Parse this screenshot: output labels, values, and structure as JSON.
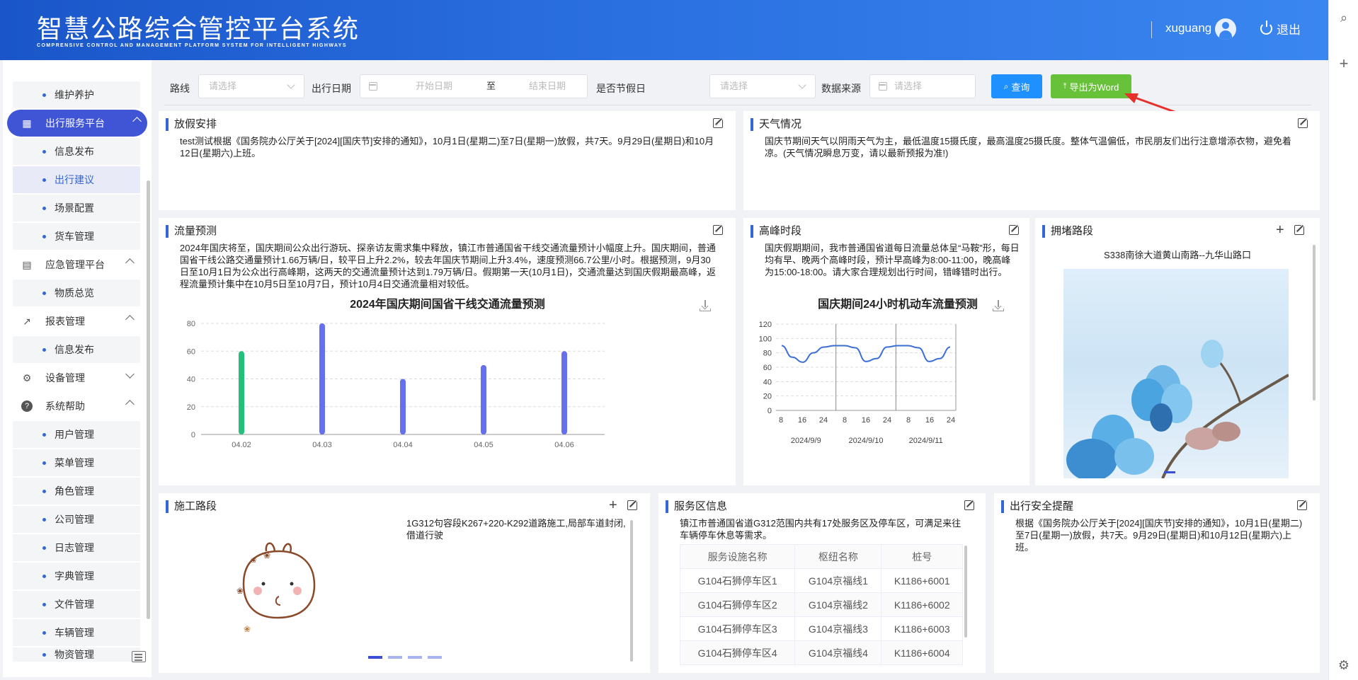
{
  "header": {
    "title": "智慧公路综合管控平台系统",
    "subtitle": "COMPRENSIVE CONTROL AND MANAGEMENT PLATFORM SYSTEM FOR INTELLIGENT HIGHWAYS",
    "username": "xuguang",
    "logout": "退出"
  },
  "sidebar": {
    "items": [
      {
        "label": "维护养护",
        "type": "sub"
      },
      {
        "label": "出行服务平台",
        "type": "group",
        "icon": "dashboard-icon",
        "active": true
      },
      {
        "label": "信息发布",
        "type": "sub"
      },
      {
        "label": "出行建议",
        "type": "sub",
        "active": true
      },
      {
        "label": "场景配置",
        "type": "sub"
      },
      {
        "label": "货车管理",
        "type": "sub"
      },
      {
        "label": "应急管理平台",
        "type": "group",
        "icon": "document-icon"
      },
      {
        "label": "物质总览",
        "type": "sub"
      },
      {
        "label": "报表管理",
        "type": "group",
        "icon": "chart-icon"
      },
      {
        "label": "信息发布",
        "type": "sub"
      },
      {
        "label": "设备管理",
        "type": "group",
        "icon": "gear-icon"
      },
      {
        "label": "系统帮助",
        "type": "group",
        "icon": "help-icon"
      },
      {
        "label": "用户管理",
        "type": "sub"
      },
      {
        "label": "菜单管理",
        "type": "sub"
      },
      {
        "label": "角色管理",
        "type": "sub"
      },
      {
        "label": "公司管理",
        "type": "sub"
      },
      {
        "label": "日志管理",
        "type": "sub"
      },
      {
        "label": "字典管理",
        "type": "sub"
      },
      {
        "label": "文件管理",
        "type": "sub"
      },
      {
        "label": "车辆管理",
        "type": "sub"
      },
      {
        "label": "物资管理",
        "type": "sub"
      }
    ]
  },
  "filter": {
    "route_label": "路线",
    "route_placeholder": "请选择",
    "date_label": "出行日期",
    "start_placeholder": "开始日期",
    "to": "至",
    "end_placeholder": "结束日期",
    "holiday_label": "是否节假日",
    "holiday_placeholder": "请选择",
    "source_label": "数据来源",
    "source_placeholder": "请选择",
    "query_button": "查询",
    "export_button": "导出为Word"
  },
  "cards": {
    "holiday": {
      "title": "放假安排",
      "text": "test测试根据《国务院办公厅关于[2024][国庆节]安排的通知》，10月1日(星期二)至7日(星期一)放假，共7天。9月29日(星期日)和10月12日(星期六)上班。"
    },
    "weather": {
      "title": "天气情况",
      "text": "国庆节期间天气以阴雨天气为主，最低温度15摄氏度，最高温度25摄氏度。整体气温偏低，市民朋友们出行注意增添衣物，避免着凉。(天气情况瞬息万变，请以最新预报为准!)"
    },
    "flow": {
      "title": "流量预测",
      "text": "2024年国庆将至，国庆期间公众出行游玩、探亲访友需求集中释放，镇江市普通国省干线交通流量预计小幅度上升。国庆期间，普通国省干线公路交通量预计1.66万辆/日，较平日上升2.2%，较去年国庆节期间上升3.4%，速度预测66.7公里/小时。根据预测，9月30日至10月1日为公众出行高峰期，这两天的交通流量预计达到1.79万辆/日。假期第一天(10月1日)，交通流量达到国庆假期最高峰，返程流量预计集中在10月5日至10月7日，预计10月4日交通流量相对较低。"
    },
    "peak": {
      "title": "高峰时段",
      "text": "国庆假期期间，我市普通国省道每日流量总体呈“马鞍”形，每日均有早、晚两个高峰时段，预计早高峰为8:00-11:00，晚高峰为15:00-18:00。请大家合理规划出行时间，错峰错时出行。"
    },
    "congestion": {
      "title": "拥堵路段",
      "road": "S338南徐大道黄山南路--九华山路口"
    },
    "construction": {
      "title": "施工路段",
      "text": "1G312句容段K267+220-K292道路施工,局部车道封闭,借道行驶"
    },
    "service": {
      "title": "服务区信息",
      "text": "镇江市普通国省道G312范围内共有17处服务区及停车区，可满足来往车辆停车休息等需求。",
      "columns": [
        "服务设施名称",
        "枢纽名称",
        "桩号"
      ],
      "rows": [
        [
          "G104石狮停车区1",
          "G104京福线1",
          "K1186+6001"
        ],
        [
          "G104石狮停车区2",
          "G104京福线2",
          "K1186+6002"
        ],
        [
          "G104石狮停车区3",
          "G104京福线3",
          "K1186+6003"
        ],
        [
          "G104石狮停车区4",
          "G104京福线4",
          "K1186+6004"
        ]
      ]
    },
    "safety": {
      "title": "出行安全提醒",
      "text": "根据《国务院办公厅关于[2024][国庆节]安排的通知》，10月1日(星期二)至7日(星期一)放假，共7天。9月29日(星期日)和10月12日(星期六)上班。"
    }
  },
  "chart_data": [
    {
      "type": "bar",
      "title": "2024年国庆期间国省干线交通流量预测",
      "categories": [
        "04.02",
        "04.03",
        "04.04",
        "04.05",
        "04.06"
      ],
      "values": [
        60,
        80,
        40,
        50,
        60
      ],
      "ylim": [
        0,
        80
      ],
      "yticks": [
        0,
        20,
        40,
        60,
        80
      ],
      "colors": [
        "#22c07a",
        "#6470ee",
        "#6470ee",
        "#6470ee",
        "#6470ee"
      ],
      "grid": true
    },
    {
      "type": "line",
      "title": "国庆期间24小时机动车流量预测",
      "x_tick_labels": [
        "8",
        "16",
        "24",
        "8",
        "16",
        "24",
        "8",
        "16",
        "24"
      ],
      "x_groups": [
        "2024/9/9",
        "2024/9/10",
        "2024/9/11"
      ],
      "ylim": [
        0,
        120
      ],
      "yticks": [
        0,
        20,
        40,
        60,
        80,
        100,
        120
      ],
      "series": [
        {
          "values": [
            90,
            74,
            67,
            80,
            88,
            90,
            90,
            87,
            68,
            72,
            88,
            90,
            90,
            87,
            68,
            72,
            88
          ]
        }
      ],
      "color": "#3a6fd6",
      "grid": true
    }
  ]
}
